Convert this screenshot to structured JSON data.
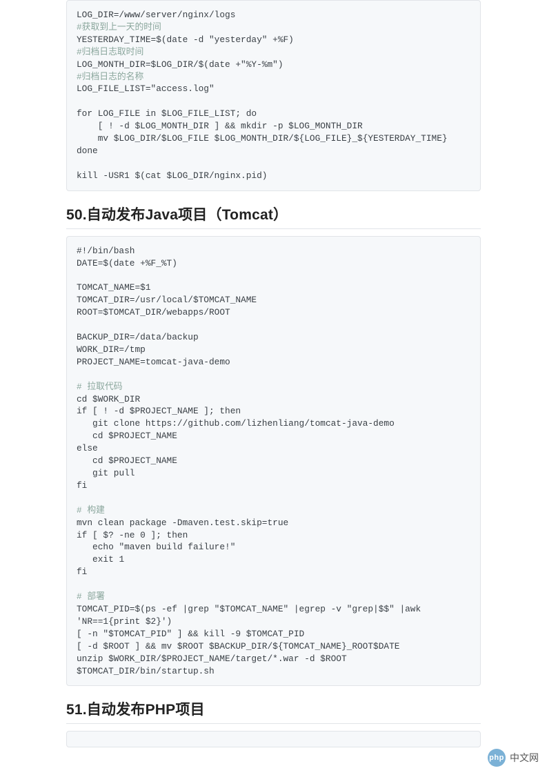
{
  "code_block_1": {
    "line1": "LOG_DIR=/www/server/nginx/logs",
    "comment1": "#获取到上一天的时间",
    "line2": "YESTERDAY_TIME=$(date -d \"yesterday\" +%F)",
    "comment2": "#归档日志取时间",
    "line3": "LOG_MONTH_DIR=$LOG_DIR/$(date +\"%Y-%m\")",
    "comment3": "#归档日志的名称",
    "line4": "LOG_FILE_LIST=\"access.log\"",
    "line5": "for LOG_FILE in $LOG_FILE_LIST; do",
    "line6": "    [ ! -d $LOG_MONTH_DIR ] && mkdir -p $LOG_MONTH_DIR",
    "line7": "    mv $LOG_DIR/$LOG_FILE $LOG_MONTH_DIR/${LOG_FILE}_${YESTERDAY_TIME}",
    "line8": "done",
    "line9": "kill -USR1 $(cat $LOG_DIR/nginx.pid)"
  },
  "heading_50": "50.自动发布Java项目（Tomcat）",
  "code_block_2": {
    "line1": "#!/bin/bash",
    "line2": "DATE=$(date +%F_%T)",
    "line3": "TOMCAT_NAME=$1",
    "line4": "TOMCAT_DIR=/usr/local/$TOMCAT_NAME",
    "line5": "ROOT=$TOMCAT_DIR/webapps/ROOT",
    "line6": "BACKUP_DIR=/data/backup",
    "line7": "WORK_DIR=/tmp",
    "line8": "PROJECT_NAME=tomcat-java-demo",
    "comment1": "# 拉取代码",
    "line9": "cd $WORK_DIR",
    "line10": "if [ ! -d $PROJECT_NAME ]; then",
    "line11": "   git clone https://github.com/lizhenliang/tomcat-java-demo",
    "line12": "   cd $PROJECT_NAME",
    "line13": "else",
    "line14": "   cd $PROJECT_NAME",
    "line15": "   git pull",
    "line16": "fi",
    "comment2": "# 构建",
    "line17": "mvn clean package -Dmaven.test.skip=true",
    "line18": "if [ $? -ne 0 ]; then",
    "line19": "   echo \"maven build failure!\"",
    "line20": "   exit 1",
    "line21": "fi",
    "comment3": "# 部署",
    "line22": "TOMCAT_PID=$(ps -ef |grep \"$TOMCAT_NAME\" |egrep -v \"grep|$$\" |awk 'NR==1{print $2}')",
    "line23": "[ -n \"$TOMCAT_PID\" ] && kill -9 $TOMCAT_PID",
    "line24": "[ -d $ROOT ] && mv $ROOT $BACKUP_DIR/${TOMCAT_NAME}_ROOT$DATE",
    "line25": "unzip $WORK_DIR/$PROJECT_NAME/target/*.war -d $ROOT",
    "line26": "$TOMCAT_DIR/bin/startup.sh"
  },
  "heading_51": "51.自动发布PHP项目",
  "watermark": {
    "logo_text": "php",
    "text": "中文网"
  }
}
